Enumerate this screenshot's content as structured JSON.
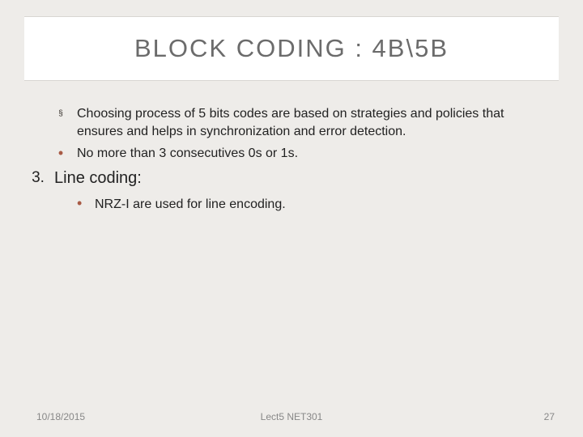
{
  "title": "BLOCK CODING : 4B\\5B",
  "bullets": {
    "b1": {
      "marker": "§",
      "text": "Choosing process of 5 bits codes are based on strategies and policies that ensures and helps in synchronization and error detection."
    },
    "b2": {
      "marker": "•",
      "text": "No more than 3 consecutives 0s or 1s."
    },
    "b3": {
      "marker": "3.",
      "text": "Line coding:"
    },
    "sub1": {
      "marker": "•",
      "text": "NRZ-I are used for line encoding."
    }
  },
  "footer": {
    "date": "10/18/2015",
    "center": "Lect5    NET301",
    "page": "27"
  }
}
